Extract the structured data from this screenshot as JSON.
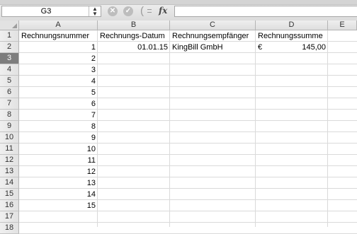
{
  "formula_bar": {
    "name_box": "G3",
    "cancel_icon": "cancel-x-icon",
    "confirm_icon": "confirm-check-icon",
    "function_icon": "fx-icon",
    "function_label": "fx",
    "formula": ""
  },
  "columns": [
    "A",
    "B",
    "C",
    "D",
    "E"
  ],
  "rows": [
    "1",
    "2",
    "3",
    "4",
    "5",
    "6",
    "7",
    "8",
    "9",
    "10",
    "11",
    "12",
    "13",
    "14",
    "15",
    "16",
    "17",
    "18"
  ],
  "selected_row": "3",
  "cells": {
    "A1": "Rechnungsnummer",
    "B1": "Rechnungs-Datum",
    "C1": "Rechnungsempfänger",
    "D1": "Rechnungssumme",
    "B2": "01.01.15",
    "C2": "KingBill GmbH",
    "D2_currency": "€",
    "D2_amount": "145,00",
    "A2": "1",
    "A3": "2",
    "A4": "3",
    "A5": "4",
    "A6": "5",
    "A7": "6",
    "A8": "7",
    "A9": "8",
    "A10": "9",
    "A11": "10",
    "A12": "11",
    "A13": "12",
    "A14": "13",
    "A15": "14",
    "A16": "15"
  }
}
